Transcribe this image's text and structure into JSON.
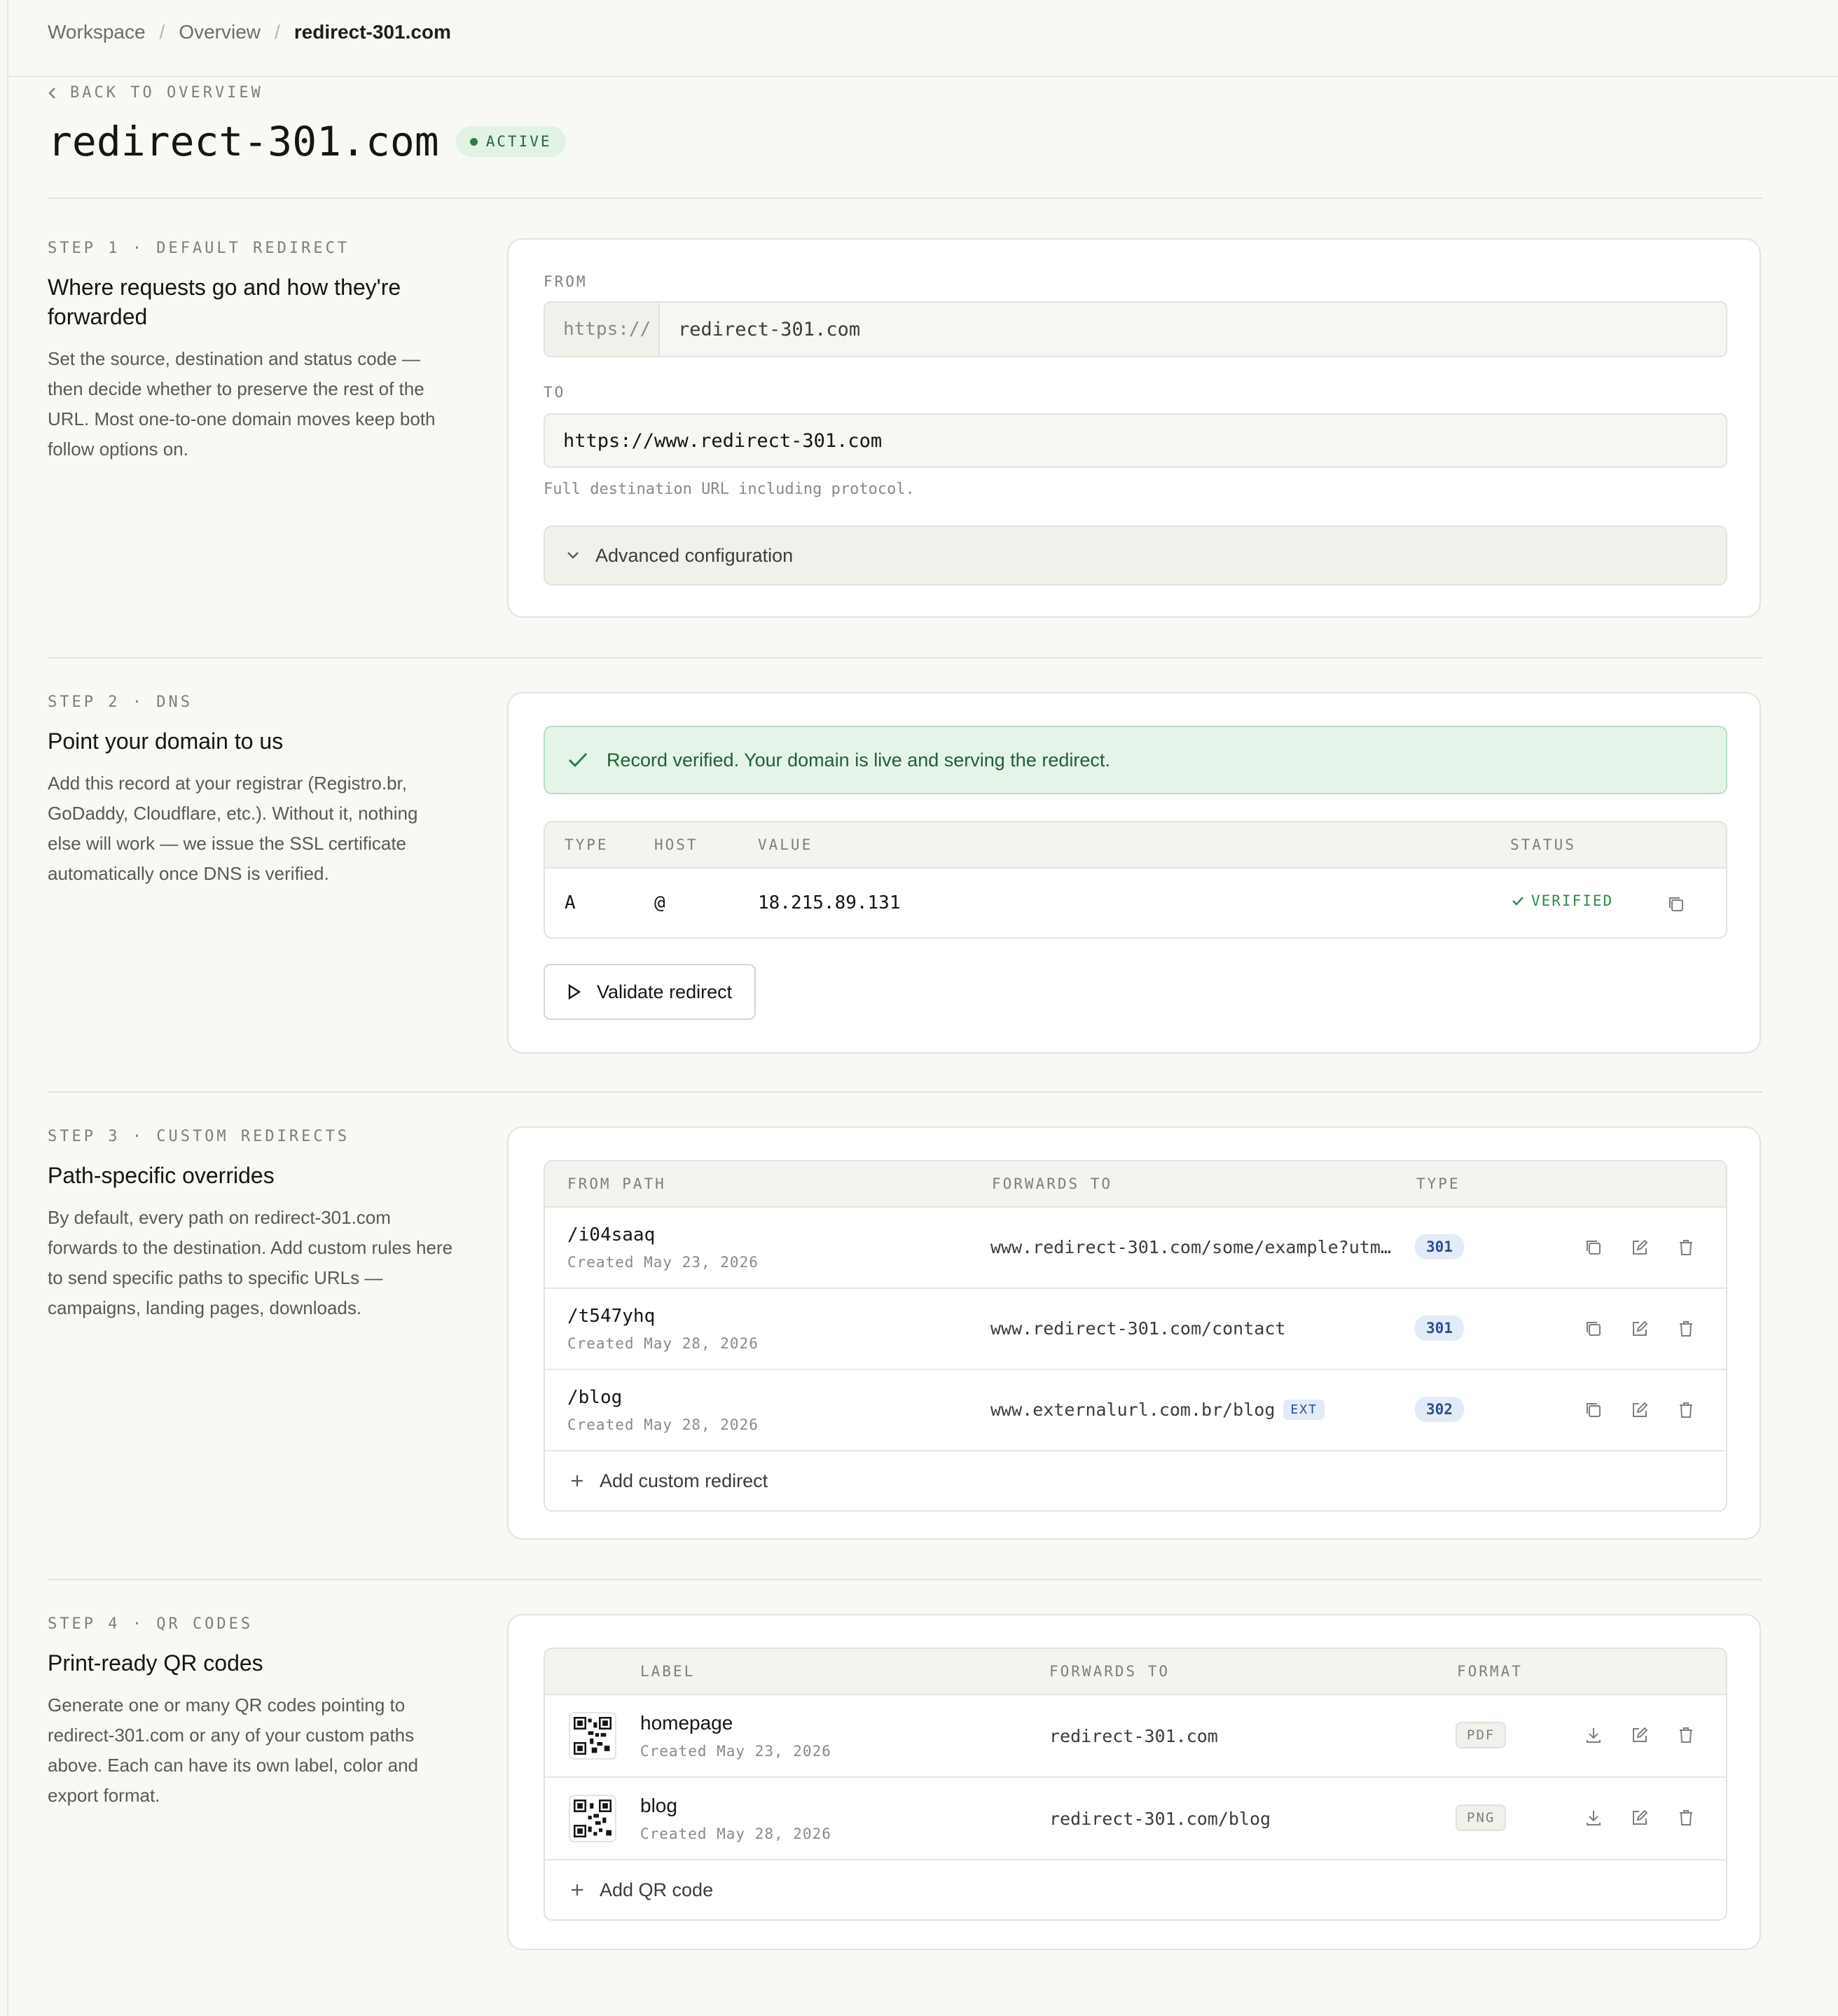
{
  "breadcrumb": {
    "items": [
      "Workspace",
      "Overview"
    ],
    "current": "redirect-301.com"
  },
  "back_label": "BACK TO OVERVIEW",
  "page": {
    "title": "redirect-301.com",
    "status": "ACTIVE"
  },
  "step1": {
    "kicker": "STEP 1 · DEFAULT REDIRECT",
    "heading": "Where requests go and how they're forwarded",
    "description": "Set the source, destination and status code — then decide whether to preserve the rest of the URL. Most one-to-one domain moves keep both follow options on.",
    "from_label": "FROM",
    "from_prefix": "https://",
    "from_value": "redirect-301.com",
    "to_label": "TO",
    "to_value": "https://www.redirect-301.com",
    "to_hint": "Full destination URL including protocol.",
    "advanced_label": "Advanced configuration"
  },
  "step2": {
    "kicker": "STEP 2 · DNS",
    "heading": "Point your domain to us",
    "description": "Add this record at your registrar (Registro.br, GoDaddy, Cloudflare, etc.). Without it, nothing else will work — we issue the SSL certificate automatically once DNS is verified.",
    "alert": "Record verified. Your domain is live and serving the redirect.",
    "columns": {
      "type": "TYPE",
      "host": "HOST",
      "value": "VALUE",
      "status": "STATUS"
    },
    "record": {
      "type": "A",
      "host": "@",
      "value": "18.215.89.131",
      "status": "VERIFIED"
    },
    "validate_label": "Validate redirect"
  },
  "step3": {
    "kicker": "STEP 3 · CUSTOM REDIRECTS",
    "heading": "Path-specific overrides",
    "description": "By default, every path on redirect-301.com forwards to the destination. Add custom rules here to send specific paths to specific URLs — campaigns, landing pages, downloads.",
    "columns": {
      "from": "FROM PATH",
      "forwards": "FORWARDS TO",
      "type": "TYPE"
    },
    "rows": [
      {
        "path": "/i04saaq",
        "created": "Created May 23, 2026",
        "forwards": "www.redirect-301.com/some/example?utm_s…",
        "ext": "",
        "code": "301"
      },
      {
        "path": "/t547yhq",
        "created": "Created May 28, 2026",
        "forwards": "www.redirect-301.com/contact",
        "ext": "",
        "code": "301"
      },
      {
        "path": "/blog",
        "created": "Created May 28, 2026",
        "forwards": "www.externalurl.com.br/blog",
        "ext": "EXT",
        "code": "302"
      }
    ],
    "add_label": "Add custom redirect"
  },
  "step4": {
    "kicker": "STEP 4 · QR CODES",
    "heading": "Print-ready QR codes",
    "description": "Generate one or many QR codes pointing to redirect-301.com or any of your custom paths above. Each can have its own label, color and export format.",
    "columns": {
      "label": "LABEL",
      "forwards": "FORWARDS TO",
      "format": "FORMAT"
    },
    "rows": [
      {
        "label": "homepage",
        "created": "Created May 23, 2026",
        "forwards": "redirect-301.com",
        "format": "PDF"
      },
      {
        "label": "blog",
        "created": "Created May 28, 2026",
        "forwards": "redirect-301.com/blog",
        "format": "PNG"
      }
    ],
    "add_label": "Add QR code"
  },
  "colors": {
    "accent_green": "#2e7d43",
    "code_blue": "#2c4f8f",
    "background": "#f8f8f4"
  }
}
